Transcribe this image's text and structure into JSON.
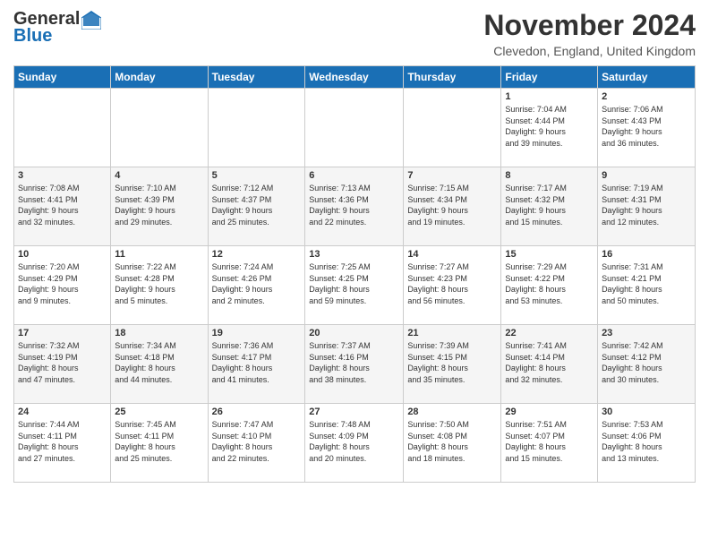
{
  "logo": {
    "general": "General",
    "blue": "Blue"
  },
  "title": "November 2024",
  "location": "Clevedon, England, United Kingdom",
  "days_of_week": [
    "Sunday",
    "Monday",
    "Tuesday",
    "Wednesday",
    "Thursday",
    "Friday",
    "Saturday"
  ],
  "weeks": [
    [
      {
        "day": "",
        "info": ""
      },
      {
        "day": "",
        "info": ""
      },
      {
        "day": "",
        "info": ""
      },
      {
        "day": "",
        "info": ""
      },
      {
        "day": "",
        "info": ""
      },
      {
        "day": "1",
        "info": "Sunrise: 7:04 AM\nSunset: 4:44 PM\nDaylight: 9 hours\nand 39 minutes."
      },
      {
        "day": "2",
        "info": "Sunrise: 7:06 AM\nSunset: 4:43 PM\nDaylight: 9 hours\nand 36 minutes."
      }
    ],
    [
      {
        "day": "3",
        "info": "Sunrise: 7:08 AM\nSunset: 4:41 PM\nDaylight: 9 hours\nand 32 minutes."
      },
      {
        "day": "4",
        "info": "Sunrise: 7:10 AM\nSunset: 4:39 PM\nDaylight: 9 hours\nand 29 minutes."
      },
      {
        "day": "5",
        "info": "Sunrise: 7:12 AM\nSunset: 4:37 PM\nDaylight: 9 hours\nand 25 minutes."
      },
      {
        "day": "6",
        "info": "Sunrise: 7:13 AM\nSunset: 4:36 PM\nDaylight: 9 hours\nand 22 minutes."
      },
      {
        "day": "7",
        "info": "Sunrise: 7:15 AM\nSunset: 4:34 PM\nDaylight: 9 hours\nand 19 minutes."
      },
      {
        "day": "8",
        "info": "Sunrise: 7:17 AM\nSunset: 4:32 PM\nDaylight: 9 hours\nand 15 minutes."
      },
      {
        "day": "9",
        "info": "Sunrise: 7:19 AM\nSunset: 4:31 PM\nDaylight: 9 hours\nand 12 minutes."
      }
    ],
    [
      {
        "day": "10",
        "info": "Sunrise: 7:20 AM\nSunset: 4:29 PM\nDaylight: 9 hours\nand 9 minutes."
      },
      {
        "day": "11",
        "info": "Sunrise: 7:22 AM\nSunset: 4:28 PM\nDaylight: 9 hours\nand 5 minutes."
      },
      {
        "day": "12",
        "info": "Sunrise: 7:24 AM\nSunset: 4:26 PM\nDaylight: 9 hours\nand 2 minutes."
      },
      {
        "day": "13",
        "info": "Sunrise: 7:25 AM\nSunset: 4:25 PM\nDaylight: 8 hours\nand 59 minutes."
      },
      {
        "day": "14",
        "info": "Sunrise: 7:27 AM\nSunset: 4:23 PM\nDaylight: 8 hours\nand 56 minutes."
      },
      {
        "day": "15",
        "info": "Sunrise: 7:29 AM\nSunset: 4:22 PM\nDaylight: 8 hours\nand 53 minutes."
      },
      {
        "day": "16",
        "info": "Sunrise: 7:31 AM\nSunset: 4:21 PM\nDaylight: 8 hours\nand 50 minutes."
      }
    ],
    [
      {
        "day": "17",
        "info": "Sunrise: 7:32 AM\nSunset: 4:19 PM\nDaylight: 8 hours\nand 47 minutes."
      },
      {
        "day": "18",
        "info": "Sunrise: 7:34 AM\nSunset: 4:18 PM\nDaylight: 8 hours\nand 44 minutes."
      },
      {
        "day": "19",
        "info": "Sunrise: 7:36 AM\nSunset: 4:17 PM\nDaylight: 8 hours\nand 41 minutes."
      },
      {
        "day": "20",
        "info": "Sunrise: 7:37 AM\nSunset: 4:16 PM\nDaylight: 8 hours\nand 38 minutes."
      },
      {
        "day": "21",
        "info": "Sunrise: 7:39 AM\nSunset: 4:15 PM\nDaylight: 8 hours\nand 35 minutes."
      },
      {
        "day": "22",
        "info": "Sunrise: 7:41 AM\nSunset: 4:14 PM\nDaylight: 8 hours\nand 32 minutes."
      },
      {
        "day": "23",
        "info": "Sunrise: 7:42 AM\nSunset: 4:12 PM\nDaylight: 8 hours\nand 30 minutes."
      }
    ],
    [
      {
        "day": "24",
        "info": "Sunrise: 7:44 AM\nSunset: 4:11 PM\nDaylight: 8 hours\nand 27 minutes."
      },
      {
        "day": "25",
        "info": "Sunrise: 7:45 AM\nSunset: 4:11 PM\nDaylight: 8 hours\nand 25 minutes."
      },
      {
        "day": "26",
        "info": "Sunrise: 7:47 AM\nSunset: 4:10 PM\nDaylight: 8 hours\nand 22 minutes."
      },
      {
        "day": "27",
        "info": "Sunrise: 7:48 AM\nSunset: 4:09 PM\nDaylight: 8 hours\nand 20 minutes."
      },
      {
        "day": "28",
        "info": "Sunrise: 7:50 AM\nSunset: 4:08 PM\nDaylight: 8 hours\nand 18 minutes."
      },
      {
        "day": "29",
        "info": "Sunrise: 7:51 AM\nSunset: 4:07 PM\nDaylight: 8 hours\nand 15 minutes."
      },
      {
        "day": "30",
        "info": "Sunrise: 7:53 AM\nSunset: 4:06 PM\nDaylight: 8 hours\nand 13 minutes."
      }
    ]
  ]
}
